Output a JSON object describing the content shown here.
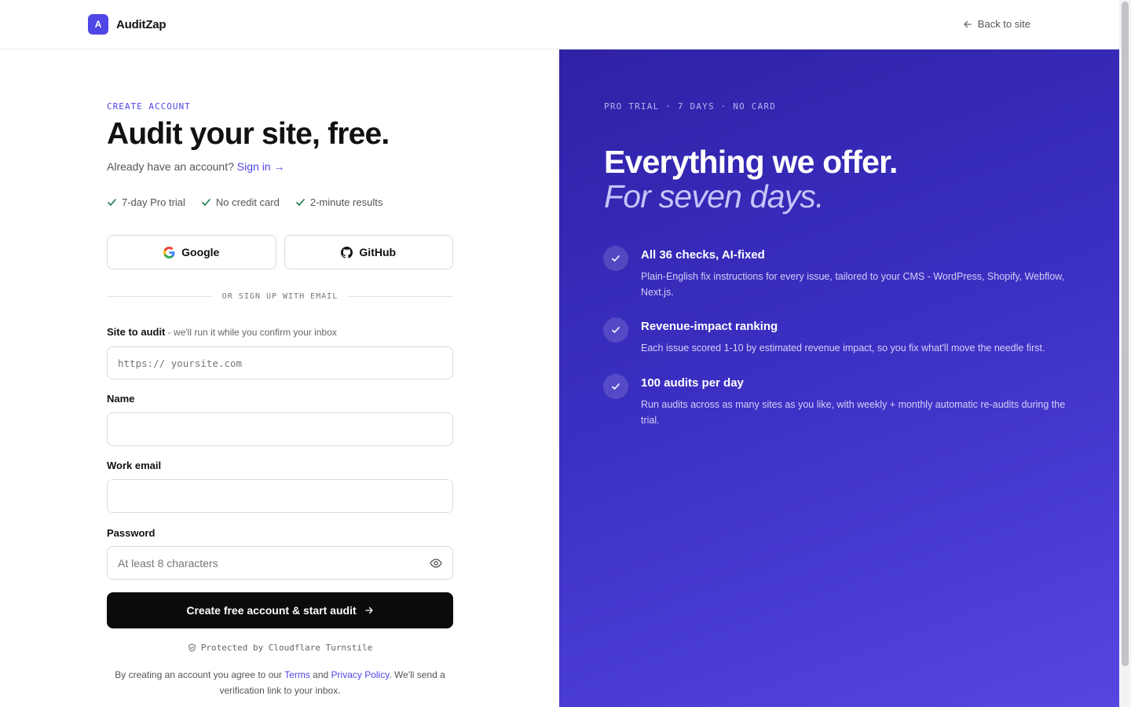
{
  "header": {
    "logo_letter": "A",
    "brand_name": "AuditZap",
    "back_label": "Back to site"
  },
  "form": {
    "eyebrow": "CREATE ACCOUNT",
    "title": "Audit your site, free.",
    "signin_prompt": "Already have an account? ",
    "signin_link": "Sign in →",
    "perks": [
      "7-day Pro trial",
      "No credit card",
      "2-minute results"
    ],
    "social": {
      "google": "Google",
      "github": "GitHub"
    },
    "divider": "OR SIGN UP WITH EMAIL",
    "site": {
      "label": "Site to audit",
      "hint": " - we'll run it while you confirm your inbox",
      "placeholder": "https:// yoursite.com",
      "value": ""
    },
    "name": {
      "label": "Name",
      "value": ""
    },
    "email": {
      "label": "Work email",
      "value": ""
    },
    "password": {
      "label": "Password",
      "placeholder": "At least 8 characters",
      "value": ""
    },
    "cta": "Create free account & start audit",
    "protected": "Protected by Cloudflare Turnstile",
    "legal": {
      "pre": "By creating an account you agree to our ",
      "terms": "Terms",
      "and": " and ",
      "privacy": "Privacy Policy",
      "post": ". We'll send a verification link to your inbox."
    }
  },
  "panel": {
    "eyebrow": "PRO TRIAL · 7 DAYS · NO CARD",
    "title_line1": "Everything we offer.",
    "title_line2": "For seven days.",
    "features": [
      {
        "title": "All 36 checks, AI-fixed",
        "desc": "Plain-English fix instructions for every issue, tailored to your CMS - WordPress, Shopify, Webflow, Next.js."
      },
      {
        "title": "Revenue-impact ranking",
        "desc": "Each issue scored 1-10 by estimated revenue impact, so you fix what'll move the needle first."
      },
      {
        "title": "100 audits per day",
        "desc": "Run audits across as many sites as you like, with weekly + monthly automatic re-audits during the trial."
      }
    ]
  },
  "colors": {
    "accent": "#4f46e5",
    "panel_start": "#2f22a6",
    "panel_end": "#5546e0",
    "cta": "#0b0b0c",
    "check": "#1f7a4d"
  }
}
